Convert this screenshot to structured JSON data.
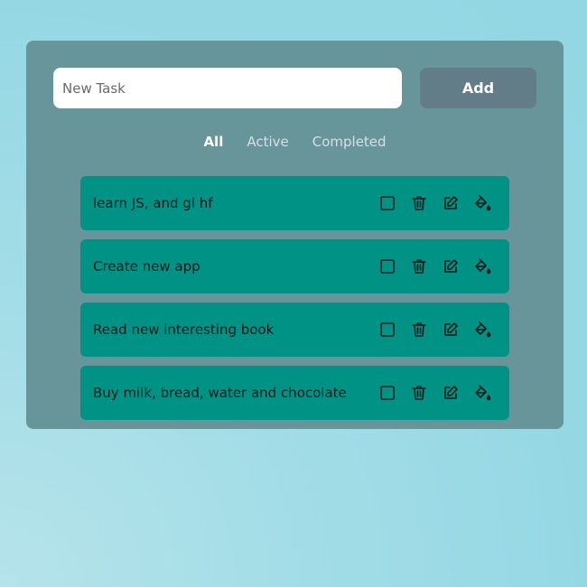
{
  "new_task": {
    "placeholder": "New Task",
    "value": ""
  },
  "add_label": "Add",
  "filters": [
    {
      "label": "All",
      "active": true
    },
    {
      "label": "Active",
      "active": false
    },
    {
      "label": "Completed",
      "active": false
    }
  ],
  "tasks": [
    {
      "text": "learn JS, and gl hf"
    },
    {
      "text": "Create new app"
    },
    {
      "text": "Read new interesting book"
    },
    {
      "text": "Buy milk, bread, water and chocolate"
    }
  ],
  "task_icons": [
    "checkbox-icon",
    "trash-icon",
    "edit-icon",
    "paint-bucket-icon"
  ],
  "colors": {
    "panel": "#689599",
    "task": "#009385",
    "add_button": "#627c88"
  }
}
